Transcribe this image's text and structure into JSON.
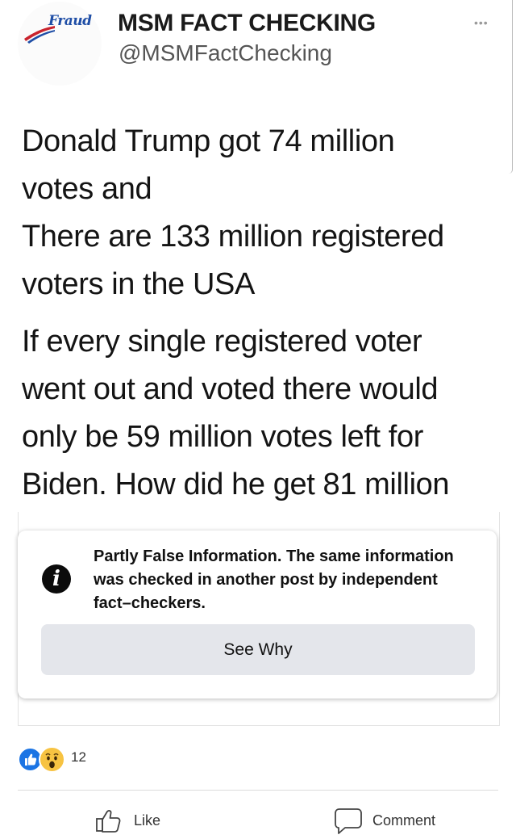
{
  "header": {
    "logo_text": "Fraud",
    "display_name": "MSM FACT CHECKING",
    "handle": "@MSMFactChecking",
    "more_icon": "more-dots-icon"
  },
  "post": {
    "paragraphs": [
      [
        "Donald Trump got 74 million",
        "votes and",
        "There are 133 million registered",
        "voters in the USA"
      ],
      [
        "If every single registered voter",
        "went out and voted there would",
        "only be 59 million votes left for",
        "Biden. How did he get 81 million"
      ]
    ]
  },
  "fact_check": {
    "icon": "info-icon",
    "lines": [
      "Partly False Information. The same information",
      "was checked in another post by independent",
      "fact–checkers."
    ],
    "button_label": "See Why"
  },
  "reactions": {
    "icons": [
      "like-reaction-icon",
      "wow-reaction-icon"
    ],
    "count": "12"
  },
  "actions": {
    "like_label": "Like",
    "comment_label": "Comment"
  },
  "colors": {
    "like_blue": "#1b74e4",
    "wow_yellow": "#f7c342",
    "button_gray": "#e4e6eb"
  }
}
